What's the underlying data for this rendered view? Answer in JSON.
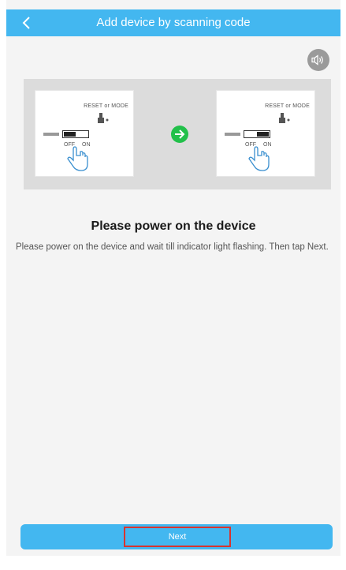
{
  "header": {
    "title": "Add device by scanning code",
    "back_icon": "chevron-left-icon",
    "background": "#43b7f0"
  },
  "speaker_icon": "speaker-icon",
  "illustration": {
    "left_card": {
      "mode_label": "RESET or MODE",
      "off_label": "OFF",
      "on_label": "ON",
      "switch_state": "off"
    },
    "right_card": {
      "mode_label": "RESET or MODE",
      "off_label": "OFF",
      "on_label": "ON",
      "switch_state": "on"
    },
    "arrow_icon": "arrow-right-icon",
    "arrow_color": "#22c04a"
  },
  "main": {
    "heading": "Please power on the device",
    "description": "Please power on the device and wait till indicator light flashing. Then tap Next."
  },
  "footer": {
    "next_label": "Next",
    "highlight_color": "#d8342f"
  }
}
